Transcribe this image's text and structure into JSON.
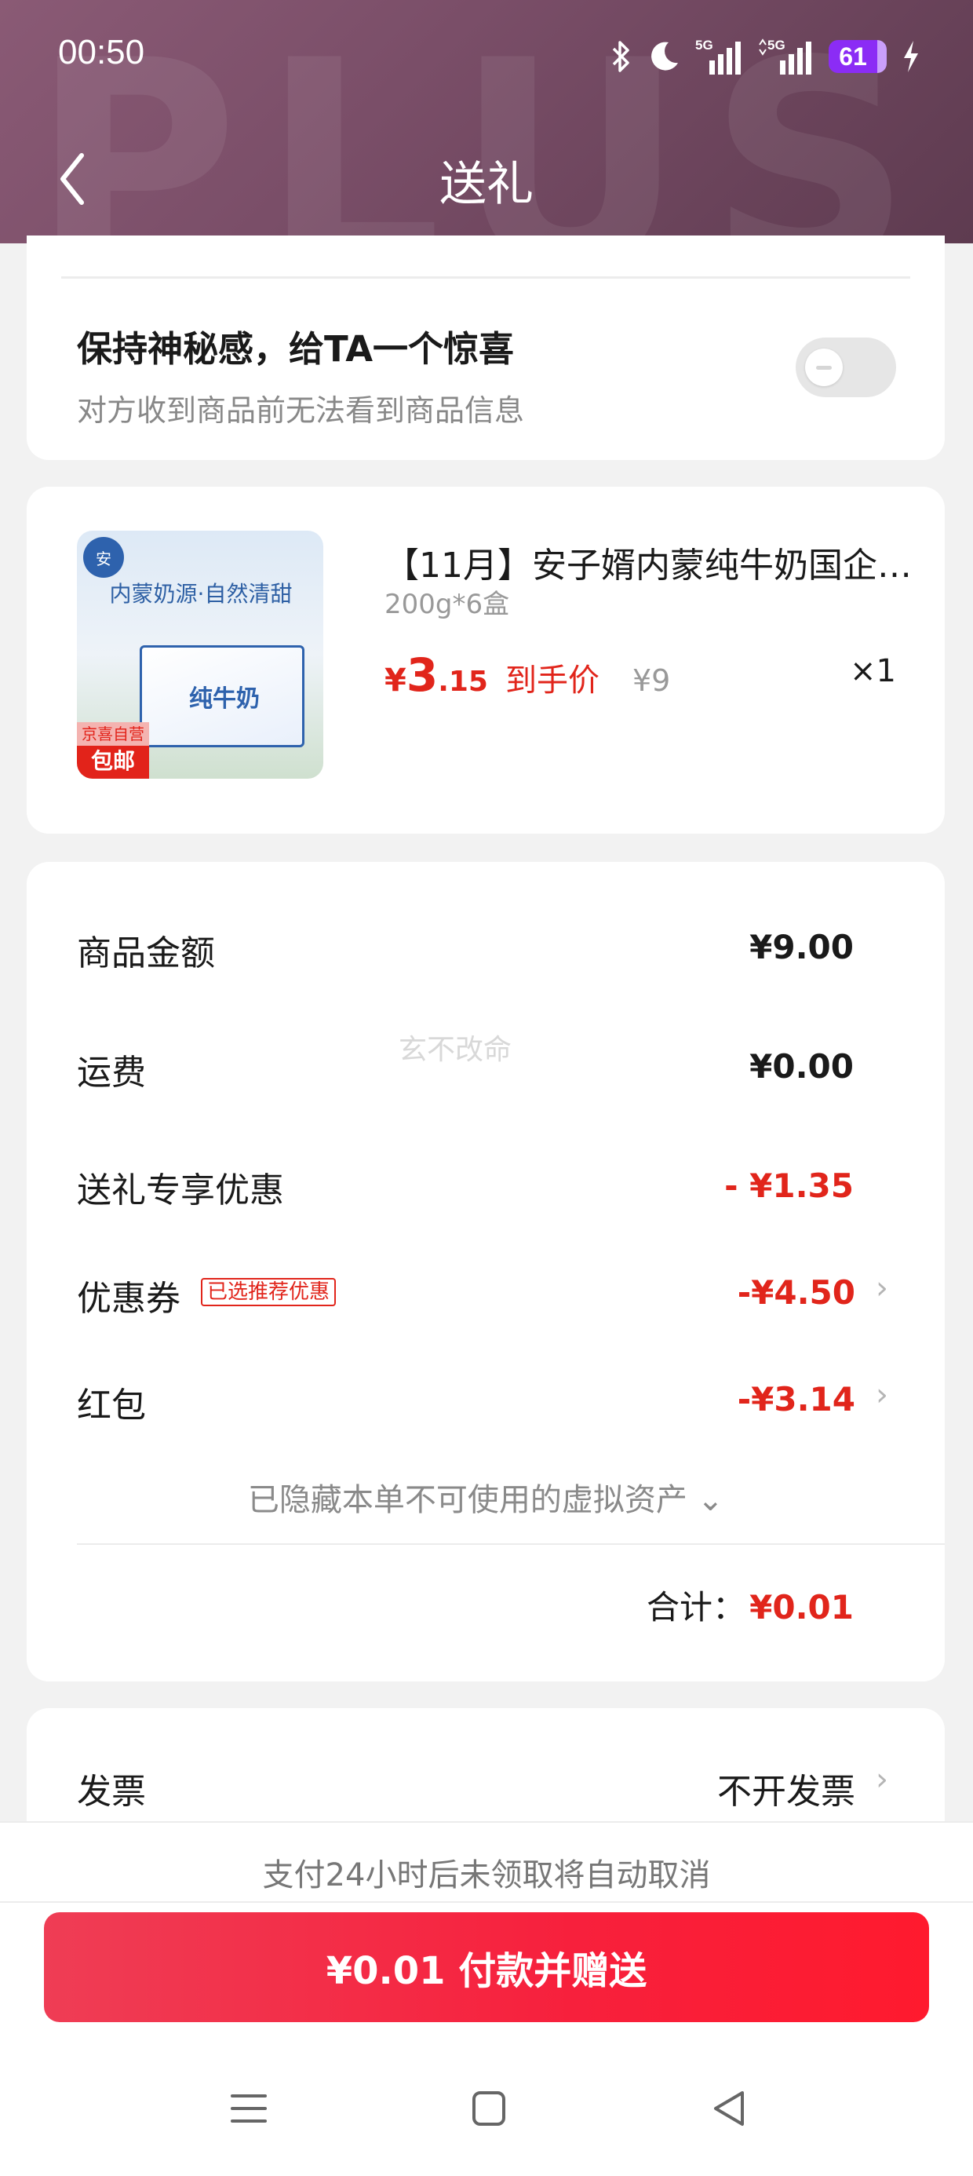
{
  "status_bar": {
    "time": "00:50",
    "battery": "61",
    "signal_labels": [
      "5G",
      "5G"
    ]
  },
  "header": {
    "title": "送礼",
    "watermark": "PLUS"
  },
  "surprise": {
    "title": "保持神秘感，给TA一个惊喜",
    "subtitle": "对方收到商品前无法看到商品信息",
    "toggle_on": false
  },
  "product": {
    "name": "【11月】安子婿内蒙纯牛奶国企…",
    "spec": "200g*6盒",
    "price_symbol": "¥",
    "price_int": "3",
    "price_dec": ".15",
    "price_label": "到手价",
    "original_price": "¥9",
    "quantity": "×1",
    "image": {
      "banner": "内蒙奶源·自然清甜",
      "badge_top": "京喜自营",
      "badge_bottom": "包邮"
    }
  },
  "summary": {
    "rows": [
      {
        "label": "商品金额",
        "value": "¥9.00"
      },
      {
        "label": "运费",
        "value": "¥0.00"
      },
      {
        "label": "送礼专享优惠",
        "value": "- ¥1.35"
      },
      {
        "label": "优惠券",
        "value": "-¥4.50",
        "tag": "已选推荐优惠"
      },
      {
        "label": "红包",
        "value": "-¥3.14"
      }
    ],
    "watermark": "玄不改命",
    "hidden_assets": "已隐藏本单不可使用的虚拟资产 ⌄",
    "total_label": "合计：",
    "total_value": "¥0.01"
  },
  "invoice": {
    "label": "发票",
    "value": "不开发票"
  },
  "bottom": {
    "cancel_note": "支付24小时后未领取将自动取消",
    "pay_button": "¥0.01 付款并赠送"
  },
  "colors": {
    "accent_red": "#e1251b",
    "header_bg": "#7a4e68",
    "button_red": "#f7203c"
  }
}
